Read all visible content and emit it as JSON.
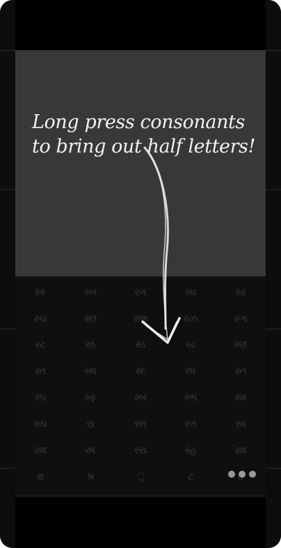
{
  "tip": {
    "line1": "Long press consonants",
    "line2": "to bring out half letters!"
  },
  "keyboard": {
    "rows": [
      [
        "સ્ક",
        "સ્ખ",
        "સ્ગ",
        "સ્ઘ",
        "સ્ઙ"
      ],
      [
        "સ્ચ",
        "સ્છ",
        "સ્જ",
        "સ્ઝ",
        "સ્ઞ"
      ],
      [
        "સ્ટ",
        "સ્ઠ",
        "સ્ડ",
        "સ્ઢ",
        "સ્ણ"
      ],
      [
        "સ્ત",
        "સ્થ",
        "સ્દ",
        "સ્ધ",
        "સ્ન"
      ],
      [
        "સ્પ",
        "સ્ફ",
        "સ્બ",
        "સ્ભ",
        "સ્મ"
      ],
      [
        "સ્ય",
        "સ્ર",
        "સ્લ",
        "સ્ળ",
        "સ્વ"
      ],
      [
        "સ્શ",
        "સ્ષ",
        "સ્સ",
        "સ્હ",
        "સ્ક્ષ"
      ],
      [
        "ક્ષ",
        "શ્ર",
        "ૃ",
        "ટ",
        "ઠ"
      ]
    ]
  },
  "pager": {
    "dots": 3,
    "color": "#9a9a9a"
  },
  "colors": {
    "panel": "#383838",
    "text": "#f2f2f2",
    "background": "#050505"
  }
}
